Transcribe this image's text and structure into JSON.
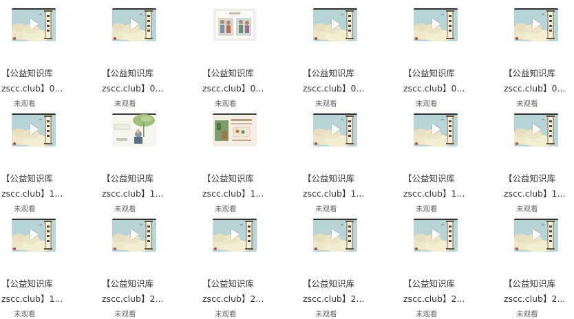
{
  "items": [
    {
      "variant": "painting",
      "line1": "【公益知识库",
      "line2": "zscc.club】0...",
      "status": "未观看"
    },
    {
      "variant": "painting",
      "line1": "【公益知识库",
      "line2": "zscc.club】0...",
      "status": "未观看"
    },
    {
      "variant": "figures",
      "line1": "【公益知识库",
      "line2": "zscc.club】0...",
      "status": "未观看"
    },
    {
      "variant": "painting",
      "line1": "【公益知识库",
      "line2": "zscc.club】0...",
      "status": "未观看"
    },
    {
      "variant": "painting",
      "line1": "【公益知识库",
      "line2": "zscc.club】0...",
      "status": "未观看"
    },
    {
      "variant": "painting",
      "line1": "【公益知识库",
      "line2": "zscc.club】0...",
      "status": "未观看"
    },
    {
      "variant": "painting",
      "line1": "【公益知识库",
      "line2": "zscc.club】1...",
      "status": "未观看"
    },
    {
      "variant": "lotus",
      "line1": "【公益知识库",
      "line2": "zscc.club】1...",
      "status": "未观看"
    },
    {
      "variant": "study",
      "line1": "【公益知识库",
      "line2": "zscc.club】1...",
      "status": "未观看"
    },
    {
      "variant": "painting",
      "line1": "【公益知识库",
      "line2": "zscc.club】1...",
      "status": "未观看"
    },
    {
      "variant": "painting",
      "line1": "【公益知识库",
      "line2": "zscc.club】1...",
      "status": "未观看"
    },
    {
      "variant": "painting",
      "line1": "【公益知识库",
      "line2": "zscc.club】1...",
      "status": "未观看"
    },
    {
      "variant": "painting",
      "line1": "【公益知识库",
      "line2": "zscc.club】1...",
      "status": "未观看"
    },
    {
      "variant": "painting",
      "line1": "【公益知识库",
      "line2": "zscc.club】2...",
      "status": "未观看"
    },
    {
      "variant": "painting",
      "line1": "【公益知识库",
      "line2": "zscc.club】2...",
      "status": "未观看"
    },
    {
      "variant": "painting",
      "line1": "【公益知识库",
      "line2": "zscc.club】2...",
      "status": "未观看"
    },
    {
      "variant": "painting",
      "line1": "【公益知识库",
      "line2": "zscc.club】2...",
      "status": "未观看"
    },
    {
      "variant": "painting",
      "line1": "【公益知识库",
      "line2": "zscc.club】2...",
      "status": "未观看"
    }
  ],
  "colors": {
    "sky": "#b9d4d6",
    "cloud": "#efe8c8",
    "scroll": "#6b5330"
  }
}
